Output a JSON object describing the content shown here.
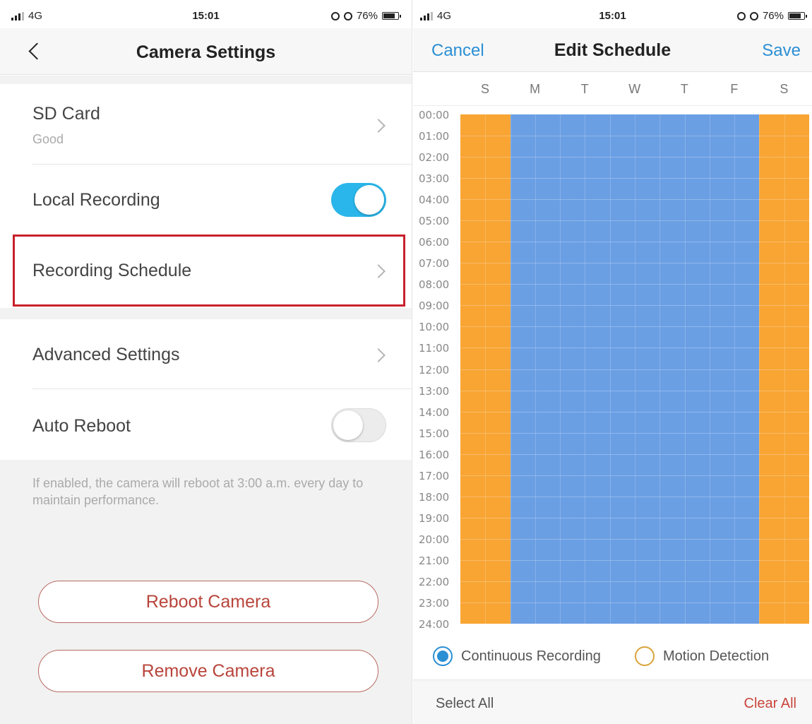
{
  "left_screen": {
    "status": {
      "carrier": "4G",
      "time": "15:01",
      "battery": "76%"
    },
    "header": {
      "title": "Camera Settings"
    },
    "items": [
      {
        "title": "SD Card",
        "subtitle": "Good"
      },
      {
        "title": "Local Recording",
        "toggle": true
      },
      {
        "title": "Recording Schedule"
      },
      {
        "title": "Advanced Settings"
      },
      {
        "title": "Auto Reboot",
        "toggle": false
      }
    ],
    "hint": "If enabled, the camera will reboot at 3:00 a.m. every day to maintain performance.",
    "buttons": {
      "reboot": "Reboot Camera",
      "remove": "Remove Camera"
    },
    "highlight_color": "#c8202c"
  },
  "right_screen": {
    "status": {
      "carrier": "4G",
      "time": "15:01",
      "battery": "76%"
    },
    "header": {
      "cancel": "Cancel",
      "title": "Edit Schedule",
      "save": "Save"
    },
    "days": [
      "S",
      "M",
      "T",
      "W",
      "T",
      "F",
      "S"
    ],
    "hours": [
      "00:00",
      "01:00",
      "02:00",
      "03:00",
      "04:00",
      "05:00",
      "06:00",
      "07:00",
      "08:00",
      "09:00",
      "10:00",
      "11:00",
      "12:00",
      "13:00",
      "14:00",
      "15:00",
      "16:00",
      "17:00",
      "18:00",
      "19:00",
      "20:00",
      "21:00",
      "22:00",
      "23:00",
      "24:00"
    ],
    "schedule_modes": [
      "motion",
      "continuous",
      "continuous",
      "continuous",
      "continuous",
      "continuous",
      "motion"
    ],
    "colors": {
      "continuous": "#6b9fe4",
      "motion": "#f8a534",
      "accent": "#2b8fd4"
    },
    "legend": {
      "continuous": "Continuous Recording",
      "motion": "Motion Detection"
    },
    "footer": {
      "select_all": "Select All",
      "clear_all": "Clear All"
    }
  }
}
